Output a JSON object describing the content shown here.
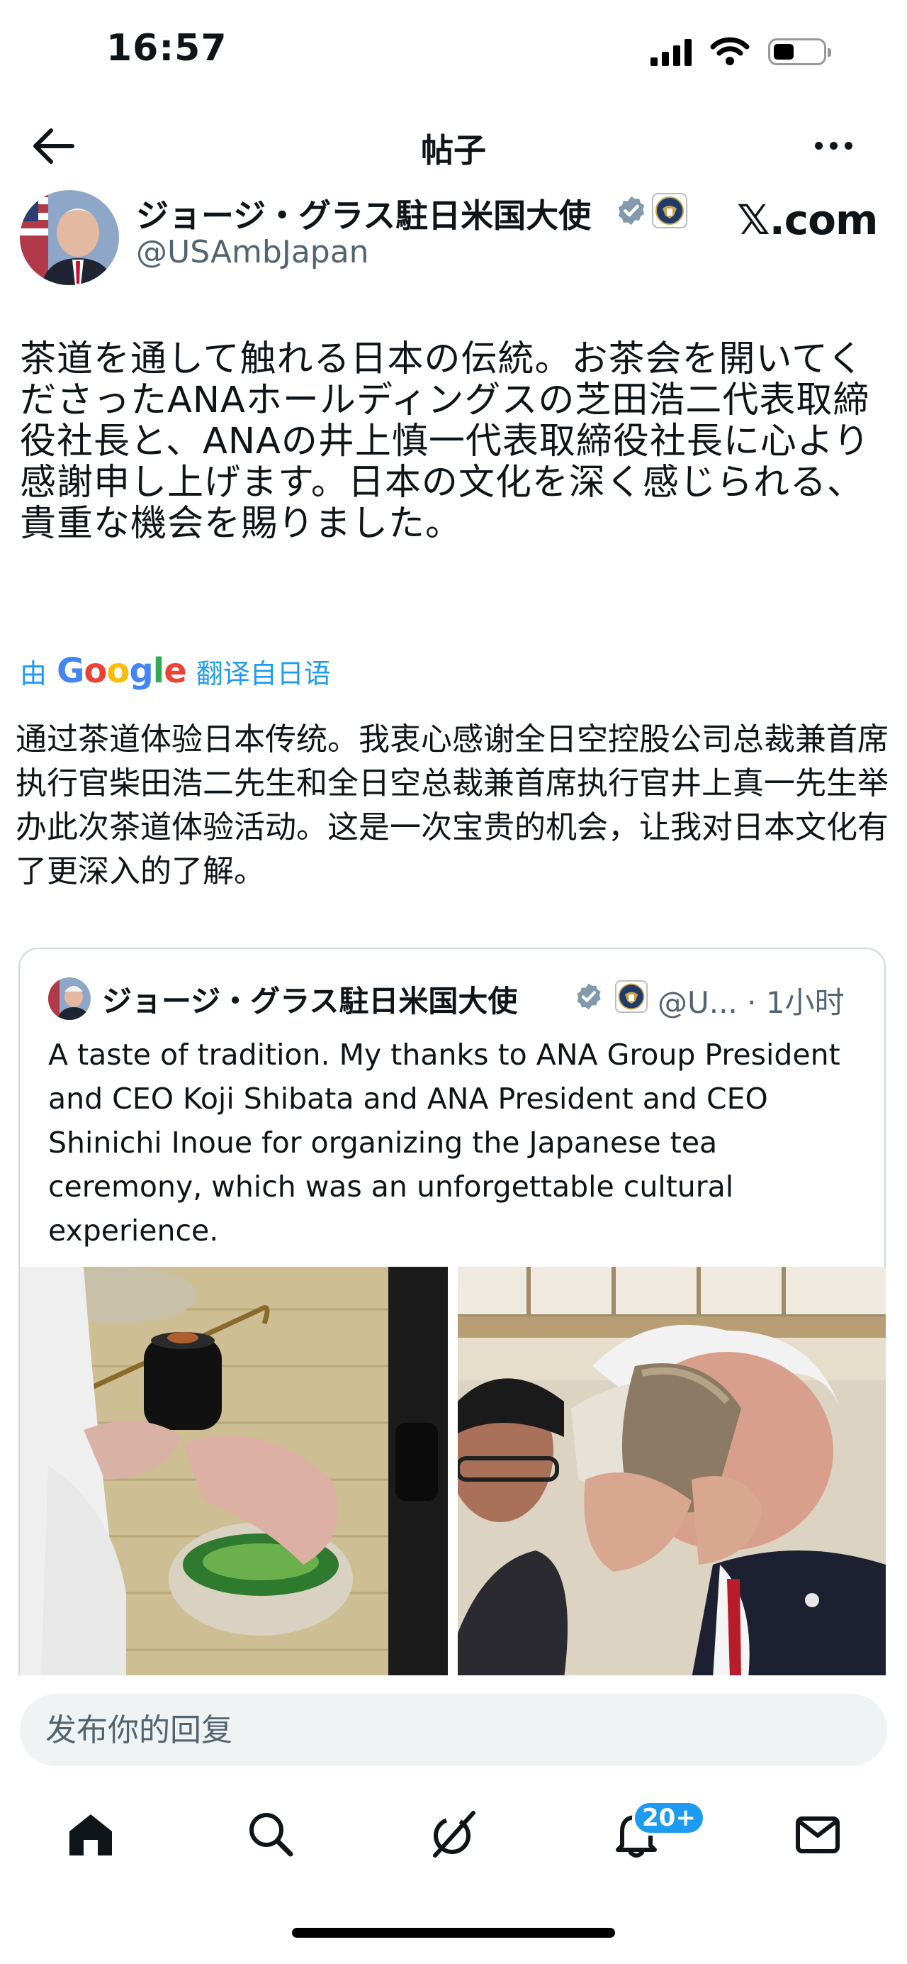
{
  "status_bar": {
    "time": "16:57"
  },
  "header": {
    "title": "帖子"
  },
  "post": {
    "author_name": "ジョージ・グラス駐日米国大使",
    "author_handle": "@USAmbJapan",
    "site_logo": "𝕏.com",
    "text": "茶道を通して触れる日本の伝統。お茶会を開いてくださったANAホールディングスの芝田浩二代表取締役社長と、ANAの井上慎一代表取締役社長に心より感謝申し上げます。日本の文化を深く感じられる、貴重な機会を賜りました。",
    "translate_prefix": "由",
    "translate_brand": "Google",
    "translate_suffix": "翻译自日语",
    "translated_text": "通过茶道体验日本传统。我衷心感谢全日空控股公司总裁兼首席执行官柴田浩二先生和全日空总裁兼首席执行官井上真一先生举办此次茶道体验活动。这是一次宝贵的机会，让我对日本文化有了更深入的了解。"
  },
  "quoted_post": {
    "author_name": "ジョージ・グラス駐日米国大使",
    "handle_time": "@U... · 1小时",
    "text": "A taste of tradition. My thanks to ANA Group President and CEO Koji Shibata and ANA President and CEO Shinichi Inoue for organizing the Japanese tea ceremony, which was an unforgettable cultural experience."
  },
  "reply": {
    "placeholder": "发布你的回复"
  },
  "bottom_nav": {
    "notifications_badge": "20+"
  },
  "colors": {
    "accent": "#1d9bf0",
    "text": "#0f1419",
    "secondary": "#536471",
    "input_bg": "#eff3f4"
  },
  "icons": [
    "back-arrow-icon",
    "more-icon",
    "verified-icon",
    "state-seal-icon",
    "home-icon",
    "search-icon",
    "grok-icon",
    "notifications-icon",
    "messages-icon"
  ]
}
